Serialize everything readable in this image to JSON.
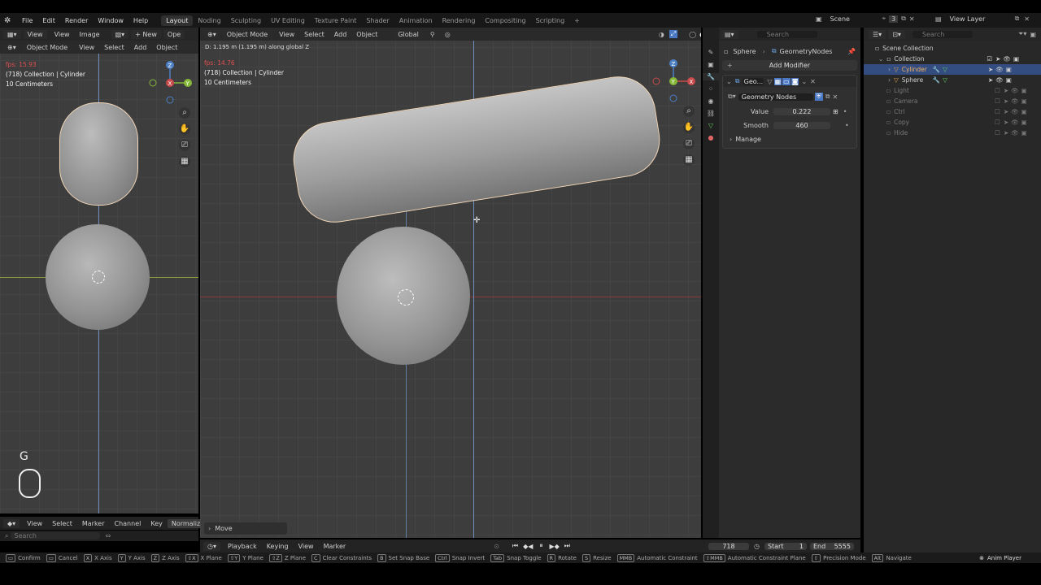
{
  "topbar": {
    "menus": [
      "File",
      "Edit",
      "Render",
      "Window",
      "Help"
    ],
    "workspaces": [
      "Layout",
      "Noding",
      "Sculpting",
      "UV Editing",
      "Texture Paint",
      "Shader",
      "Animation",
      "Rendering",
      "Compositing",
      "Scripting"
    ],
    "active_workspace": "Layout",
    "add_tab": "+",
    "scene_name": "Scene",
    "scene_count": "3",
    "view_layer": "View Layer"
  },
  "uv_editor": {
    "header": [
      "View",
      "View",
      "Image"
    ],
    "new_label": "+ New",
    "open_label": "Ope"
  },
  "left_view": {
    "mode": "Object Mode",
    "menus": [
      "View",
      "Select",
      "Add",
      "Object"
    ],
    "fps": "fps: 15.93",
    "collection": "(718) Collection | Cylinder",
    "scale": "10 Centimeters",
    "key_hint": "G"
  },
  "main_view": {
    "mode": "Object Mode",
    "menus": [
      "View",
      "Select",
      "Add",
      "Object"
    ],
    "orientation": "Global",
    "status": "D: 1.195 m (1.195 m) along global Z",
    "fps": "fps: 14.76",
    "collection": "(718) Collection | Cylinder",
    "scale": "10 Centimeters",
    "operator_panel": "Move"
  },
  "properties": {
    "breadcrumb_object": "Sphere",
    "breadcrumb_tree": "GeometryNodes",
    "add_modifier": "Add Modifier",
    "modifier_name": "Geo...",
    "node_group": "Geometry Nodes",
    "value_label": "Value",
    "value": "0.222",
    "smooth_label": "Smooth",
    "smooth": "460",
    "manage": "Manage"
  },
  "outliner": {
    "search_placeholder": "Search",
    "root": "Scene Collection",
    "collection": "Collection",
    "items": [
      {
        "name": "Cylinder",
        "selected": true,
        "active": true
      },
      {
        "name": "Sphere",
        "selected": false,
        "active": true
      },
      {
        "name": "Light",
        "selected": false,
        "active": false
      },
      {
        "name": "Camera",
        "selected": false,
        "active": false
      },
      {
        "name": "Ctrl",
        "selected": false,
        "active": false
      },
      {
        "name": "Copy",
        "selected": false,
        "active": false
      },
      {
        "name": "Hide",
        "selected": false,
        "active": false
      }
    ]
  },
  "dopesheet": {
    "menus": [
      "View",
      "Select",
      "Marker",
      "Channel",
      "Key"
    ],
    "normalize": "Normalize",
    "search_placeholder": "Search"
  },
  "timeline": {
    "menus": [
      "Playback",
      "Keying",
      "View",
      "Marker"
    ],
    "current_frame": "718",
    "start_label": "Start",
    "start": "1",
    "end_label": "End",
    "end": "5555"
  },
  "search_placeholder": "Search",
  "statusbar": [
    {
      "key": "",
      "label": "Confirm"
    },
    {
      "key": "",
      "label": "Cancel"
    },
    {
      "key": "X",
      "label": "X Axis"
    },
    {
      "key": "Y",
      "label": "Y Axis"
    },
    {
      "key": "Z",
      "label": "Z Axis"
    },
    {
      "key": "⇧X",
      "label": "X Plane"
    },
    {
      "key": "⇧Y",
      "label": "Y Plane"
    },
    {
      "key": "⇧Z",
      "label": "Z Plane"
    },
    {
      "key": "C",
      "label": "Clear Constraints"
    },
    {
      "key": "B",
      "label": "Set Snap Base"
    },
    {
      "key": "Ctrl",
      "label": "Snap Invert"
    },
    {
      "key": "Tab",
      "label": "Snap Toggle"
    },
    {
      "key": "R",
      "label": "Rotate"
    },
    {
      "key": "S",
      "label": "Resize"
    },
    {
      "key": "MMB",
      "label": "Automatic Constraint"
    },
    {
      "key": "⇧MMB",
      "label": "Automatic Constraint Plane"
    },
    {
      "key": "⇧",
      "label": "Precision Mode"
    },
    {
      "key": "Alt",
      "label": "Navigate"
    }
  ],
  "anim_player": "Anim Player",
  "colors": {
    "selection_outline": "#f3d7b8",
    "x_axis": "#c94a4a",
    "y_axis": "#86b83a",
    "z_axis": "#4d7fc6",
    "accent": "#4a78c4"
  }
}
